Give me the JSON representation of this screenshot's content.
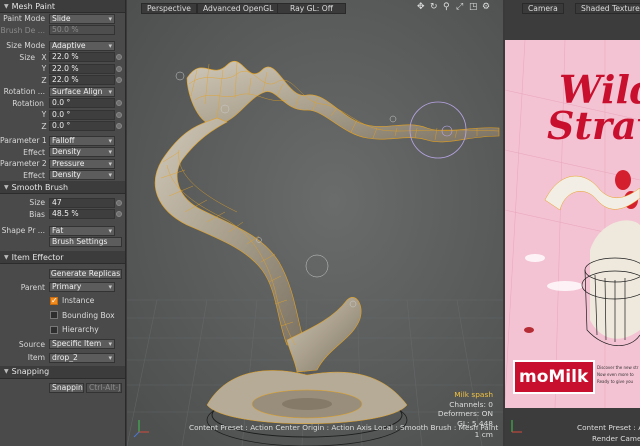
{
  "left_panel": {
    "mesh_paint": {
      "title": "Mesh Paint",
      "paint_mode_label": "Paint Mode",
      "paint_mode_value": "Slide",
      "brush_de_label": "Brush De ...",
      "brush_de_value": "50.0 %",
      "size_mode_label": "Size Mode",
      "size_mode_value": "Adaptive",
      "size_label": "Size",
      "size_x": "22.0 %",
      "size_y": "22.0 %",
      "size_z": "22.0 %",
      "axis_x": "X",
      "axis_y": "Y",
      "axis_z": "Z",
      "rotation_label": "Rotation ...",
      "rotation_value": "Surface Align",
      "rotation2_label": "Rotation",
      "rot_x": "0.0 °",
      "rot_y": "0.0 °",
      "rot_z": "0.0 °",
      "param1_label": "Parameter 1",
      "param1_value": "Falloff",
      "effect1_label": "Effect",
      "effect1_value": "Density",
      "param2_label": "Parameter 2",
      "param2_value": "Pressure",
      "effect2_label": "Effect",
      "effect2_value": "Density"
    },
    "smooth_brush": {
      "title": "Smooth Brush",
      "size_label": "Size",
      "size_value": "47",
      "bias_label": "Bias",
      "bias_value": "48.5 %",
      "shape_label": "Shape Pr ...",
      "shape_value": "Fat",
      "brush_settings": "Brush Settings"
    },
    "item_effector": {
      "title": "Item Effector",
      "generate": "Generate Replicas",
      "parent_label": "Parent",
      "parent_value": "Primary",
      "instance": "Instance",
      "instance_checked": true,
      "bounding_box": "Bounding Box",
      "bounding_box_checked": false,
      "hierarchy": "Hierarchy",
      "hierarchy_checked": false,
      "source_label": "Source",
      "source_value": "Specific Item",
      "item_label": "Item",
      "item_value": "drop_2"
    },
    "snapping": {
      "title": "Snapping",
      "button": "Snapping",
      "shortcut": "Ctrl-Alt-J"
    }
  },
  "viewport_main": {
    "toolbar": {
      "view": "Perspective",
      "shading": "Advanced OpenGL",
      "raygl": "Ray GL: Off"
    },
    "icons": [
      "move-icon",
      "rotate-icon",
      "search-icon",
      "zoom-icon",
      "fit-icon",
      "gear-icon"
    ],
    "stats": {
      "name": "Milk spash",
      "channels": "Channels: 0",
      "deformers": "Deformers: ON",
      "gl": "GL: 5,448",
      "scale": "1 cm"
    },
    "status": "Content Preset : Action Center Origin : Action Axis Local : Smooth Brush : Mesh Paint"
  },
  "viewport_render": {
    "toolbar": {
      "camera": "Camera",
      "shading": "Shaded Texture"
    },
    "ad": {
      "title1": "Wild",
      "title2": "Straw",
      "brand": "moMilk",
      "copy": [
        "Discover the new str",
        "Now even more to",
        "Ready to give you"
      ]
    },
    "status": "Content Preset : Actio",
    "status2": "Render Camera"
  },
  "colors": {
    "accent": "#f08a1c",
    "wire": "#e6a21c",
    "brand_red": "#c8102e",
    "bg_pink": "#f7c6d6"
  }
}
